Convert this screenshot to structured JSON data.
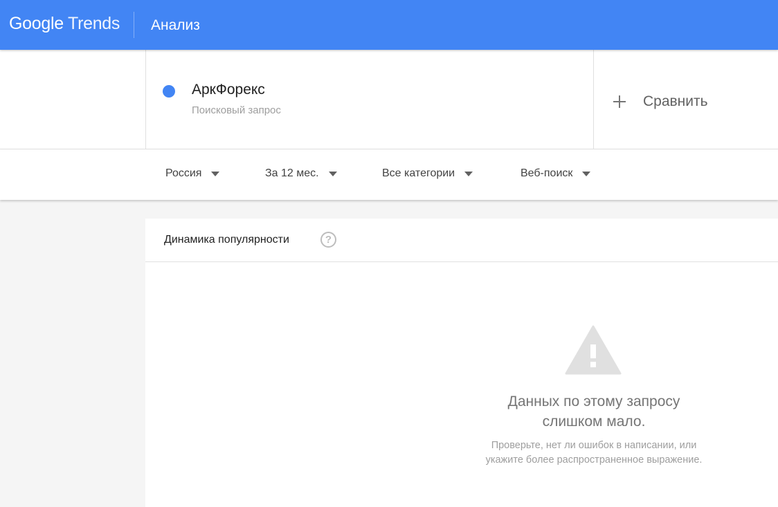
{
  "header": {
    "logo_google": "Google",
    "logo_trends": "Trends",
    "page_title": "Анализ",
    "bar_color": "#4285f4"
  },
  "term": {
    "name": "АркФорекс",
    "type": "Поисковый запрос",
    "dot_color": "#4285f4"
  },
  "compare": {
    "icon": "plus-icon",
    "label": "Сравнить"
  },
  "filters": {
    "region": "Россия",
    "period": "За 12 мес.",
    "category": "Все категории",
    "search_type": "Веб-поиск"
  },
  "panel": {
    "title": "Динамика популярности",
    "help_icon": "help-icon",
    "help_glyph": "?",
    "warning_icon": "warning-icon",
    "empty_title_line1": "Данных по этому запросу",
    "empty_title_line2": "слишком мало.",
    "empty_hint_line1": "Проверьте, нет ли ошибок в написании, или",
    "empty_hint_line2": "укажите более распространенное выражение."
  }
}
